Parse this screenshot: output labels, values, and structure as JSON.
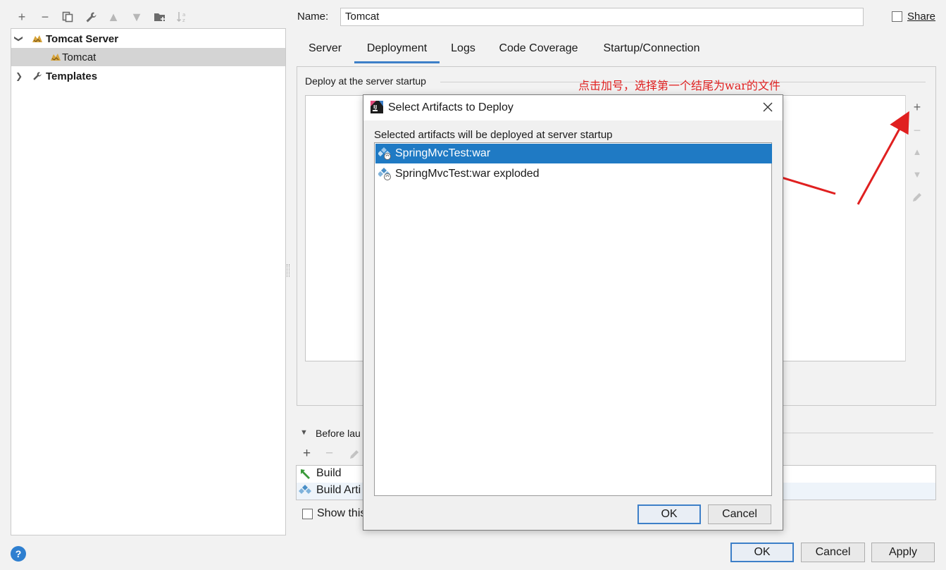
{
  "toolbar": {
    "icons": [
      "plus-icon",
      "minus-icon",
      "copy-icon",
      "wrench-icon",
      "move-up-icon",
      "move-down-icon",
      "folder-add-icon",
      "sort-icon"
    ]
  },
  "tree": {
    "items": [
      {
        "label": "Tomcat Server",
        "expanded": true,
        "bold": true
      },
      {
        "label": "Tomcat",
        "selected": true
      },
      {
        "label": "Templates",
        "expanded": false,
        "bold": true
      }
    ]
  },
  "name_field": {
    "label": "Name:",
    "value": "Tomcat"
  },
  "share": {
    "label": "Share",
    "checked": false
  },
  "tabs": [
    {
      "label": "Server",
      "active": false
    },
    {
      "label": "Deployment",
      "active": true
    },
    {
      "label": "Logs",
      "active": false
    },
    {
      "label": "Code Coverage",
      "active": false
    },
    {
      "label": "Startup/Connection",
      "active": false
    }
  ],
  "deploy": {
    "label": "Deploy at the server startup"
  },
  "annotation": {
    "text": "点击加号，选择第一个结尾为war的文件",
    "color": "#e02020"
  },
  "before_launch": {
    "label": "Before lau",
    "items": [
      {
        "label": "Build",
        "icon": "hammer-icon"
      },
      {
        "label": "Build Arti",
        "icon": "artifact-icon"
      }
    ],
    "show_this": "Show this"
  },
  "dialog": {
    "title": "Select Artifacts to Deploy",
    "subtitle": "Selected artifacts will be deployed at server startup",
    "artifacts": [
      {
        "label": "SpringMvcTest:war",
        "selected": true
      },
      {
        "label": "SpringMvcTest:war exploded",
        "selected": false
      }
    ],
    "ok": "OK",
    "cancel": "Cancel"
  },
  "footer": {
    "ok": "OK",
    "cancel": "Cancel",
    "apply": "Apply",
    "help": "?"
  },
  "colors": {
    "accent": "#3d7fc8",
    "selection": "#1f7ac4",
    "annotation": "#e02020"
  }
}
